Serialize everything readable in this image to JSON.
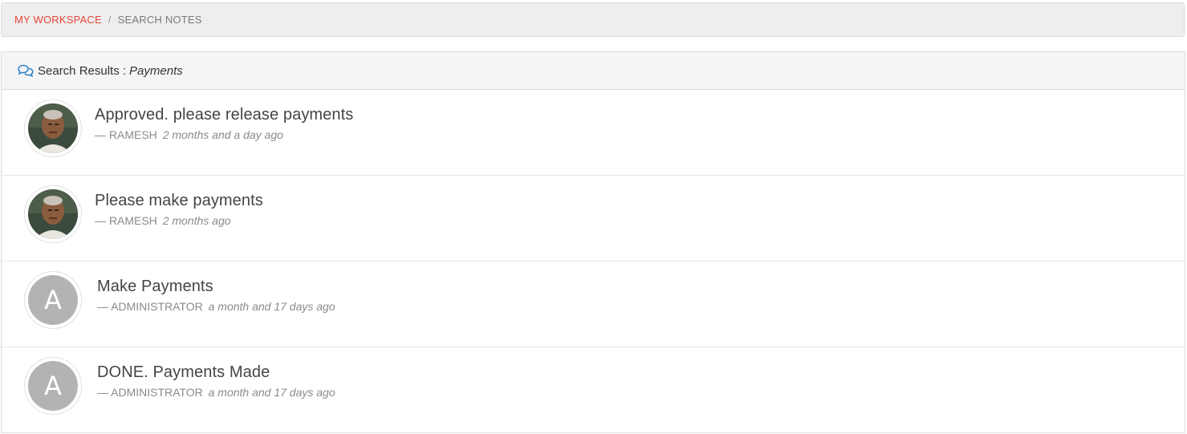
{
  "breadcrumb": {
    "home_label": "MY WORKSPACE",
    "separator": "/",
    "current_label": "SEARCH NOTES",
    "home_color": "#e8473b"
  },
  "panel": {
    "icon": "comments-icon",
    "heading_prefix": "Search Results :",
    "query": "Payments"
  },
  "results": [
    {
      "title": "Approved. please release payments",
      "dash": "—",
      "author": "RAMESH",
      "time": "2 months and a day ago",
      "avatar_type": "photo",
      "avatar_letter": ""
    },
    {
      "title": "Please make payments",
      "dash": "—",
      "author": "RAMESH",
      "time": "2 months ago",
      "avatar_type": "photo",
      "avatar_letter": ""
    },
    {
      "title": "Make Payments",
      "dash": "—",
      "author": "ADMINISTRATOR",
      "time": "a month and 17 days ago",
      "avatar_type": "letter",
      "avatar_letter": "A"
    },
    {
      "title": "DONE. Payments Made",
      "dash": "—",
      "author": "ADMINISTRATOR",
      "time": "a month and 17 days ago",
      "avatar_type": "letter",
      "avatar_letter": "A"
    }
  ]
}
